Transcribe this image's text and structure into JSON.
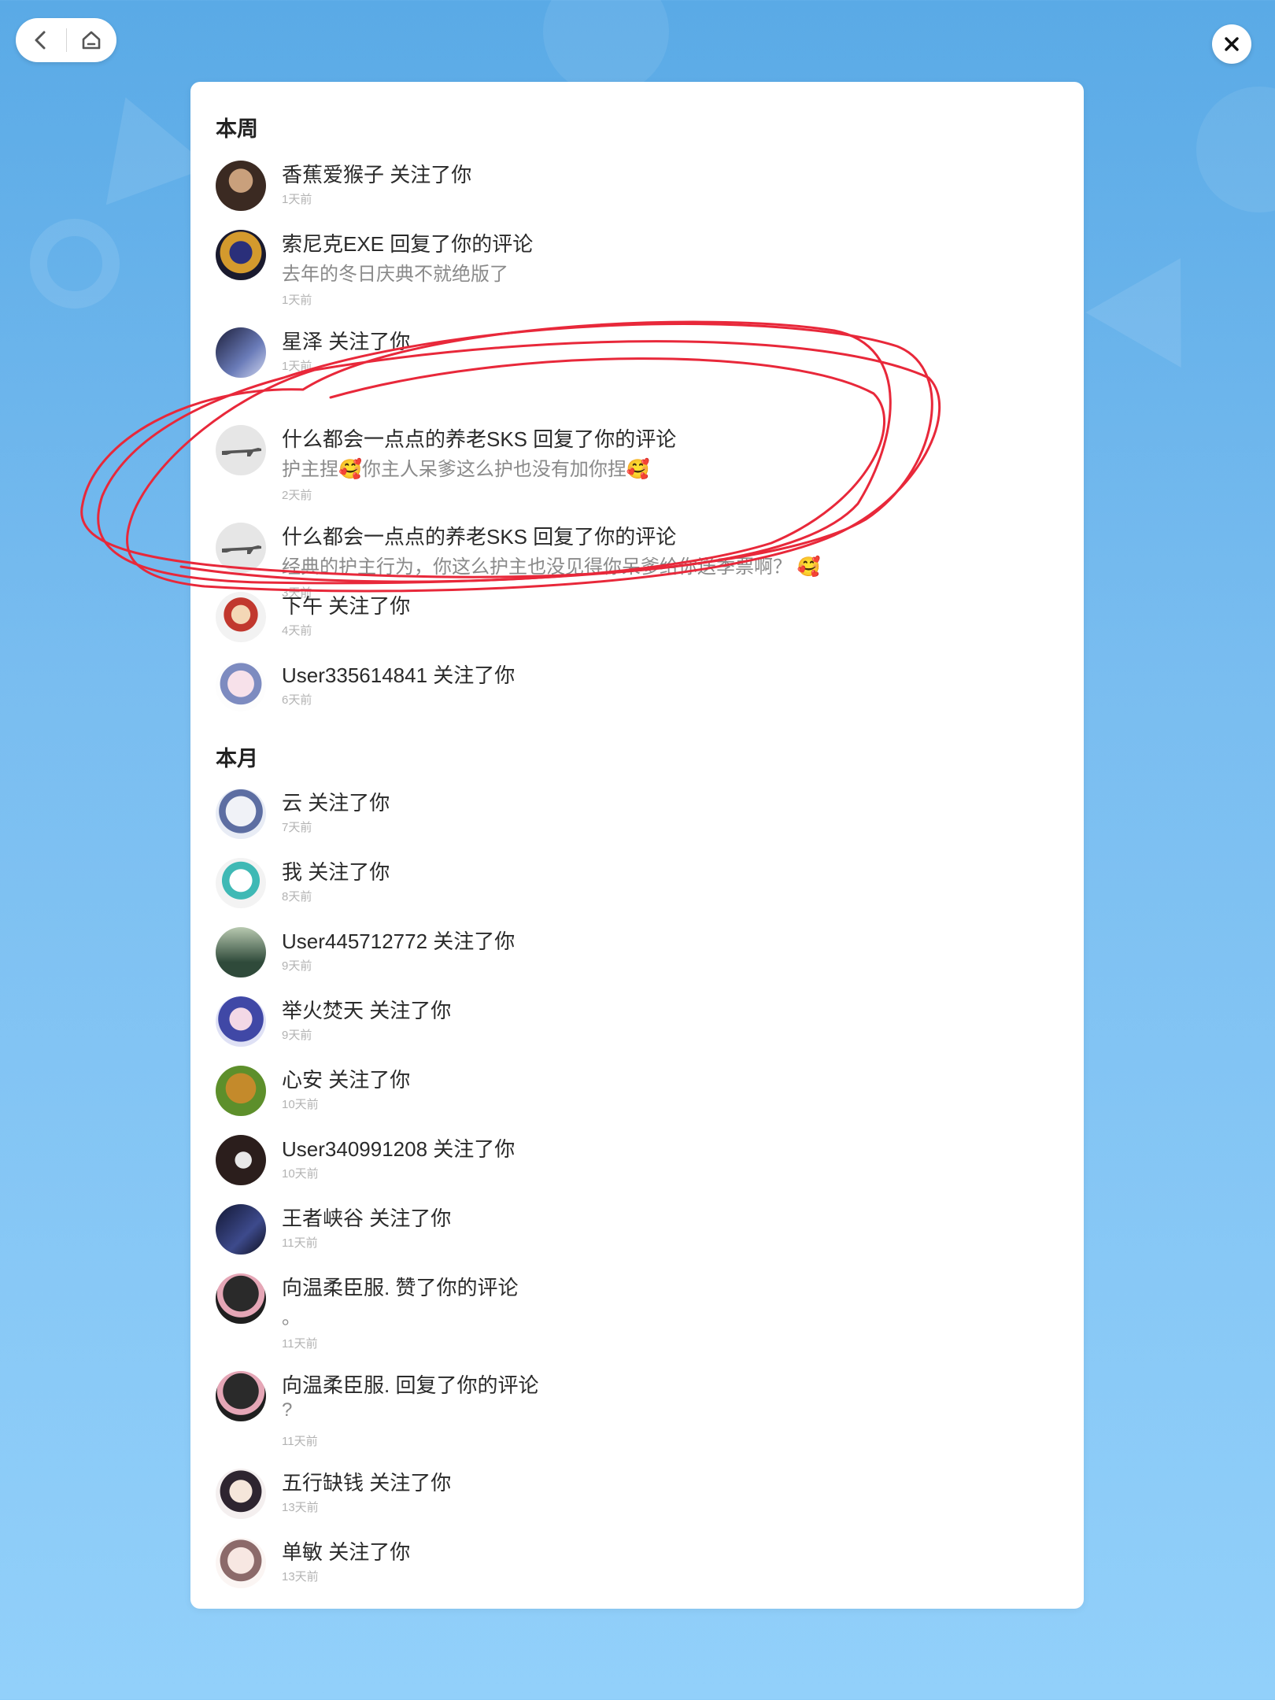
{
  "sections": {
    "this_week": "本周",
    "this_month": "本月"
  },
  "icons": {
    "back": "chevron-left-icon",
    "home": "home-icon",
    "close": "close-icon"
  },
  "colors": {
    "background_top": "#5aaae6",
    "background_bottom": "#92d0fa",
    "annotation": "#e8283a"
  },
  "notifications": [
    {
      "text": "香蕉爱猴子 关注了你",
      "sub": "",
      "time": "1天前"
    },
    {
      "text": "索尼克EXE 回复了你的评论",
      "sub": "去年的冬日庆典不就绝版了",
      "time": "1天前"
    },
    {
      "text": "星泽 关注了你",
      "sub": "",
      "time": "1天前"
    },
    {
      "text": "什么都会一点点的养老SKS 回复了你的评论",
      "sub": "护主捏🥰你主人呆爹这么护也没有加你捏🥰",
      "time": "2天前"
    },
    {
      "text": "什么都会一点点的养老SKS 回复了你的评论",
      "sub": "经典的护主行为，你这么护主也没见得你呆爹给你送季票啊？ 🥰",
      "time": "3天前"
    },
    {
      "text": "下午 关注了你",
      "sub": "",
      "time": "4天前"
    },
    {
      "text": "User335614841 关注了你",
      "sub": "",
      "time": "6天前"
    },
    {
      "text": "云 关注了你",
      "sub": "",
      "time": "7天前"
    },
    {
      "text": "我 关注了你",
      "sub": "",
      "time": "8天前"
    },
    {
      "text": "User445712772 关注了你",
      "sub": "",
      "time": "9天前"
    },
    {
      "text": "举火焚天 关注了你",
      "sub": "",
      "time": "9天前"
    },
    {
      "text": "心安 关注了你",
      "sub": "",
      "time": "10天前"
    },
    {
      "text": "User340991208 关注了你",
      "sub": "",
      "time": "10天前"
    },
    {
      "text": "王者峡谷 关注了你",
      "sub": "",
      "time": "11天前"
    },
    {
      "text": "向温柔臣服. 赞了你的评论",
      "sub": "。",
      "time": "11天前"
    },
    {
      "text": "向温柔臣服. 回复了你的评论",
      "sub": "?",
      "time": "11天前"
    },
    {
      "text": "五行缺钱 关注了你",
      "sub": "",
      "time": "13天前"
    },
    {
      "text": "单敏 关注了你",
      "sub": "",
      "time": "13天前"
    }
  ]
}
